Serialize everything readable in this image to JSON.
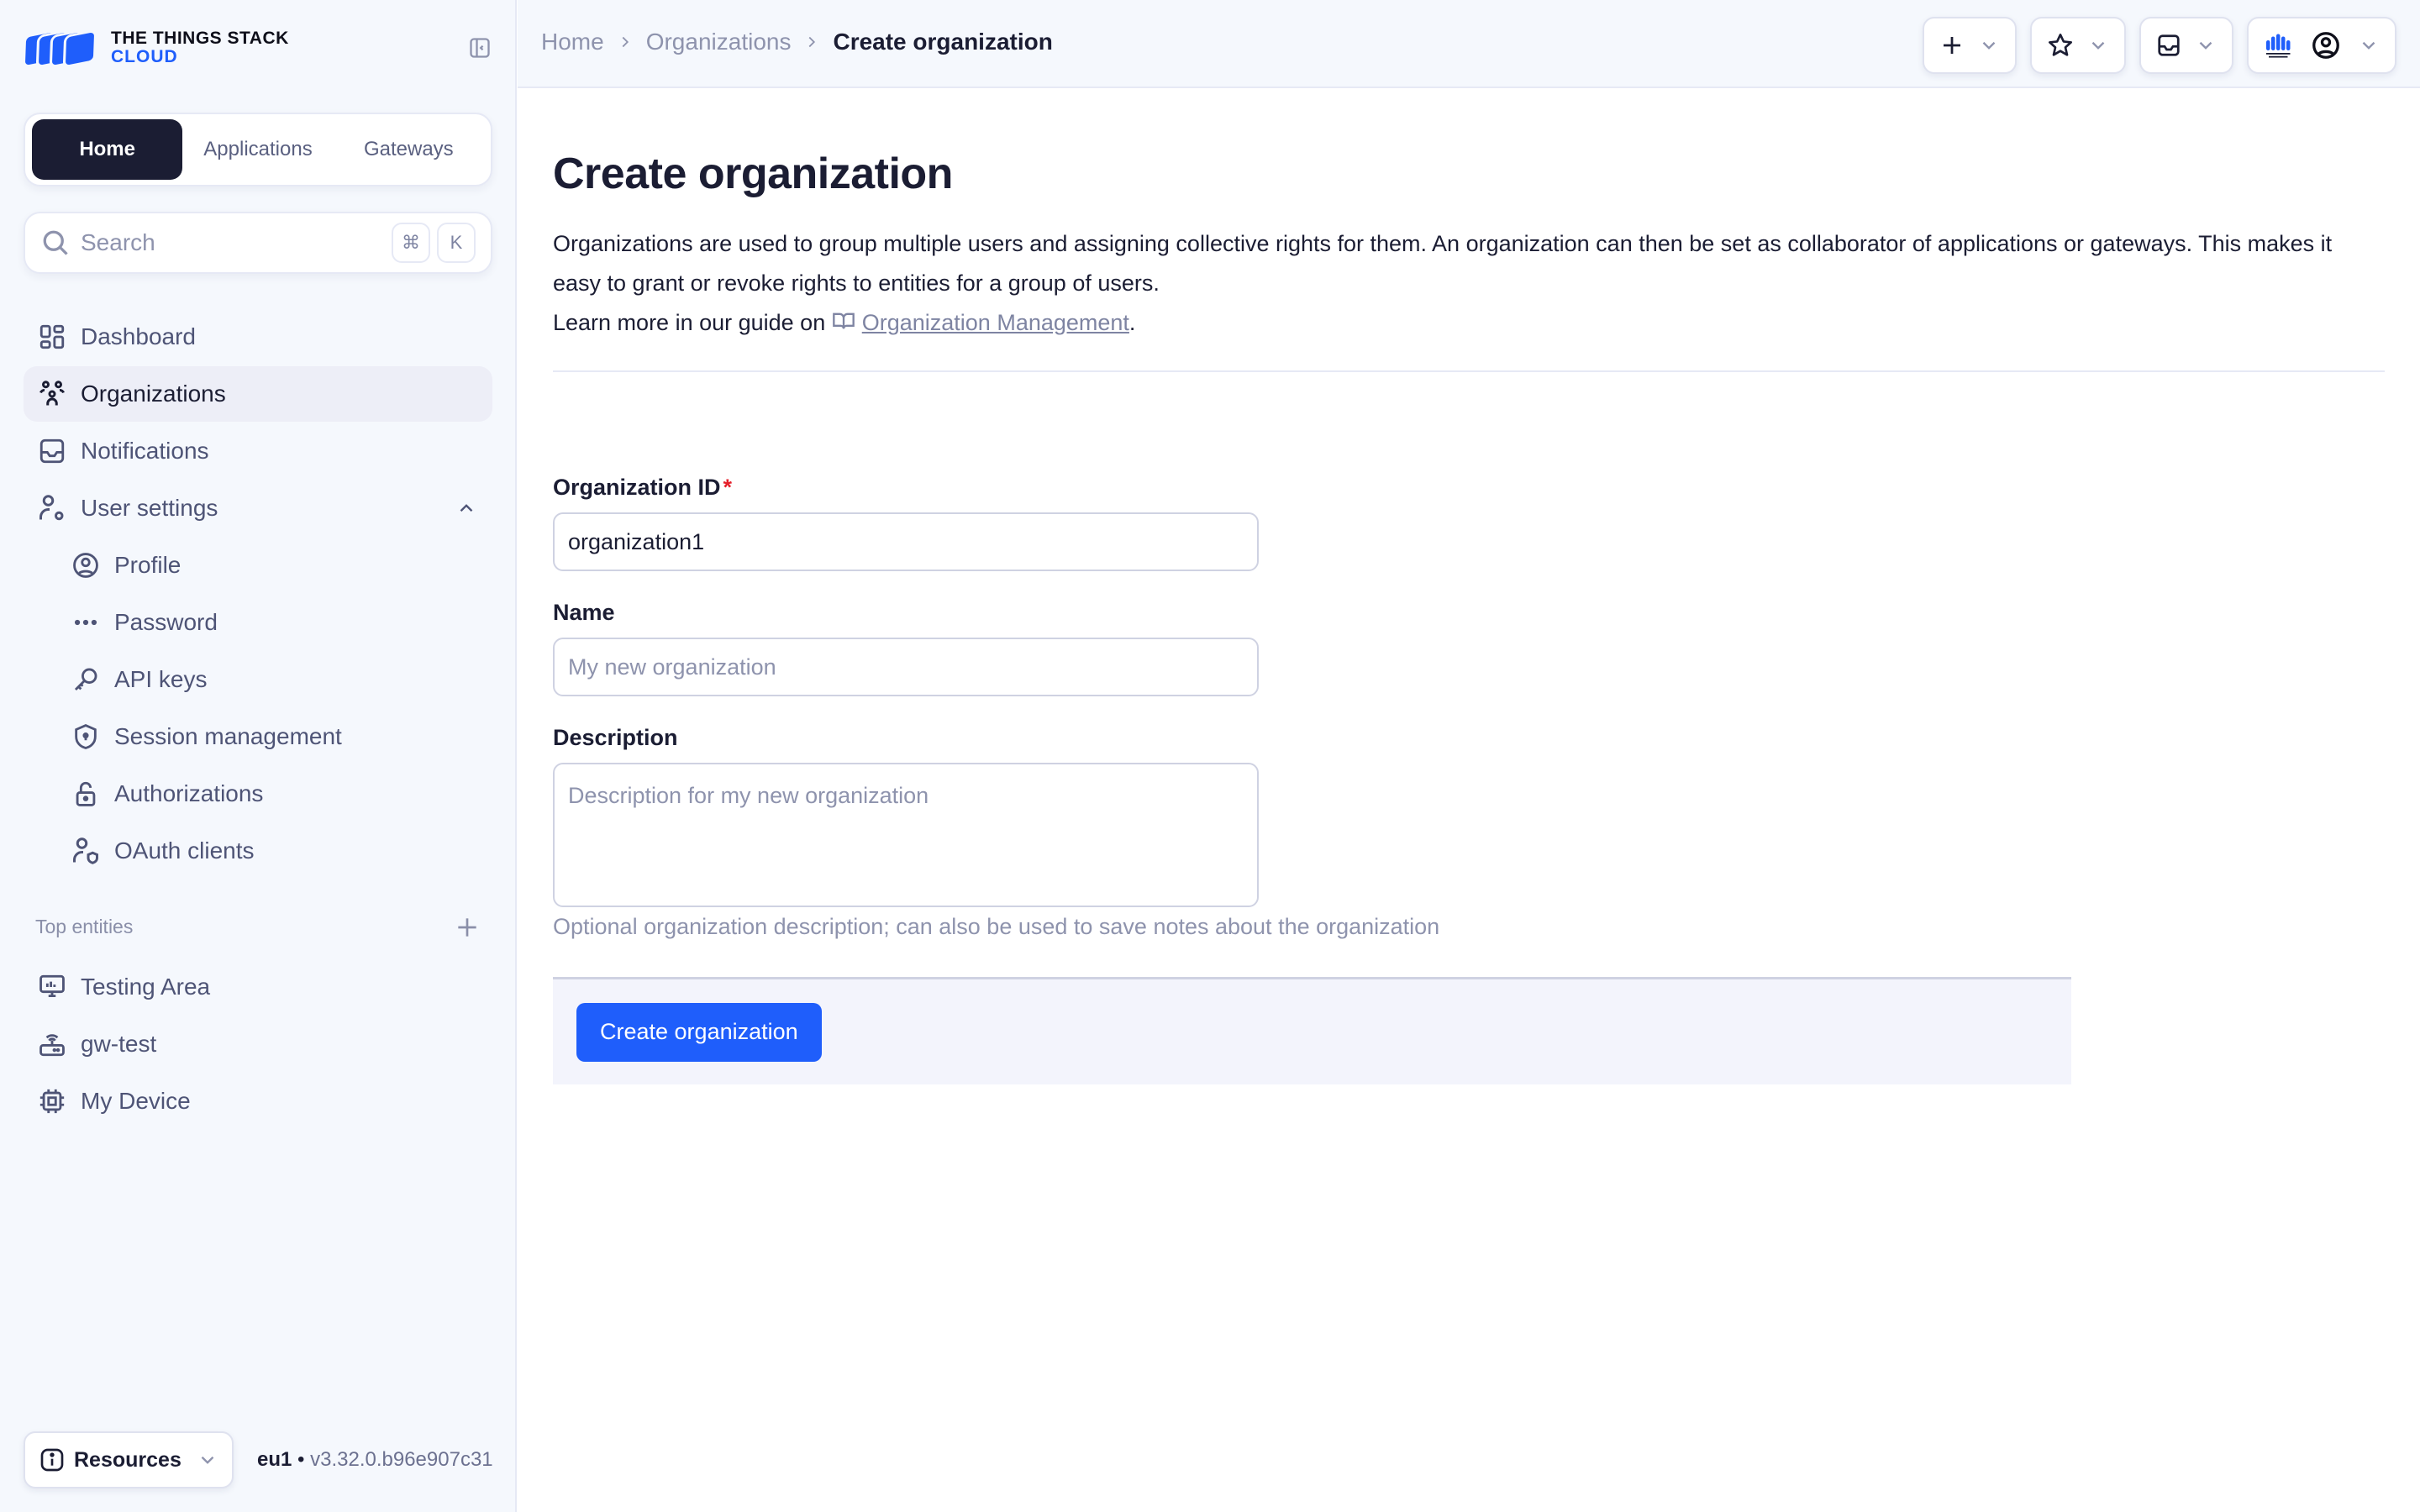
{
  "brand": {
    "line1": "THE THINGS STACK",
    "line2": "CLOUD",
    "accent": "#1f5efb"
  },
  "switcher": {
    "tabs": [
      {
        "label": "Home",
        "active": true
      },
      {
        "label": "Applications",
        "active": false
      },
      {
        "label": "Gateways",
        "active": false
      }
    ]
  },
  "search": {
    "placeholder": "Search",
    "shortcut_mod": "⌘",
    "shortcut_key": "K"
  },
  "nav": {
    "items": [
      {
        "label": "Dashboard",
        "icon": "dashboard-icon"
      },
      {
        "label": "Organizations",
        "icon": "organizations-icon",
        "active": true
      },
      {
        "label": "Notifications",
        "icon": "inbox-icon"
      },
      {
        "label": "User settings",
        "icon": "user-settings-icon",
        "expanded": true
      }
    ],
    "sub_items": [
      {
        "label": "Profile",
        "icon": "profile-icon"
      },
      {
        "label": "Password",
        "icon": "password-icon"
      },
      {
        "label": "API keys",
        "icon": "key-icon"
      },
      {
        "label": "Session management",
        "icon": "shield-icon"
      },
      {
        "label": "Authorizations",
        "icon": "unlock-icon"
      },
      {
        "label": "OAuth clients",
        "icon": "oauth-client-icon"
      }
    ]
  },
  "top_entities": {
    "label": "Top entities",
    "items": [
      {
        "label": "Testing Area",
        "icon": "application-icon"
      },
      {
        "label": "gw-test",
        "icon": "gateway-icon"
      },
      {
        "label": "My Device",
        "icon": "device-icon"
      }
    ]
  },
  "footer": {
    "resources_label": "Resources",
    "cluster": "eu1",
    "separator": "•",
    "version": "v3.32.0.b96e907c31"
  },
  "breadcrumb": {
    "items": [
      "Home",
      "Organizations"
    ],
    "current": "Create organization"
  },
  "page": {
    "title": "Create organization",
    "description": "Organizations are used to group multiple users and assigning collective rights for them. An organization can then be set as collaborator of applications or gateways. This makes it easy to grant or revoke rights to entities for a group of users.",
    "guide_prefix": "Learn more in our guide on",
    "guide_link": "Organization Management",
    "guide_suffix": "."
  },
  "form": {
    "org_id": {
      "label": "Organization ID",
      "required_mark": "*",
      "value": "organization1"
    },
    "name": {
      "label": "Name",
      "value": "",
      "placeholder": "My new organization"
    },
    "description": {
      "label": "Description",
      "value": "",
      "placeholder": "Description for my new organization",
      "hint": "Optional organization description; can also be used to save notes about the organization"
    },
    "submit_label": "Create organization"
  }
}
